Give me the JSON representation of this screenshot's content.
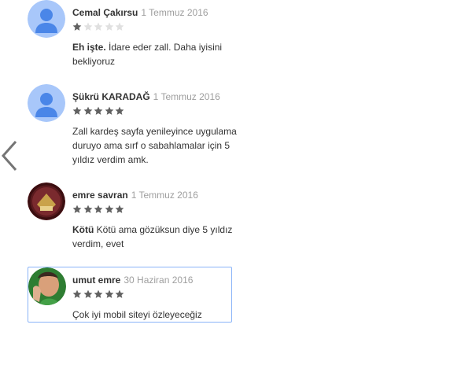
{
  "reviews": [
    {
      "author": "Cemal Çakırsu",
      "date": "1 Temmuz 2016",
      "rating": 1,
      "title": "Eh işte.",
      "text": "İdare eder zall. Daha iyisini bekliyoruz",
      "avatar": "default-avatar-icon"
    },
    {
      "author": "Şükrü KARADAĞ",
      "date": "1 Temmuz 2016",
      "rating": 5,
      "title": "",
      "text": "Zall kardeş sayfa yenileyince uygulama duruyo ama sırf o sabahlamalar için 5 yıldız verdim amk.",
      "avatar": "default-avatar-icon"
    },
    {
      "author": "emre savran",
      "date": "1 Temmuz 2016",
      "rating": 5,
      "title": "Kötü",
      "text": "Kötü ama gözüksun diye 5 yıldız verdim, evet",
      "avatar": "photo-avatar"
    },
    {
      "author": "umut emre",
      "date": "30 Haziran 2016",
      "rating": 5,
      "title": "",
      "text": "Çok iyi mobil siteyi özleyeceğiz",
      "avatar": "photo-avatar"
    }
  ],
  "colors": {
    "star_filled": "#616161",
    "star_empty": "#e0e0e0",
    "avatar_bg": "#a8c7fa",
    "avatar_fg": "#4a86e8",
    "selected_border": "#8ab4f8",
    "arrow": "#757575"
  },
  "nav": {
    "prev_icon": "chevron-left-icon"
  }
}
